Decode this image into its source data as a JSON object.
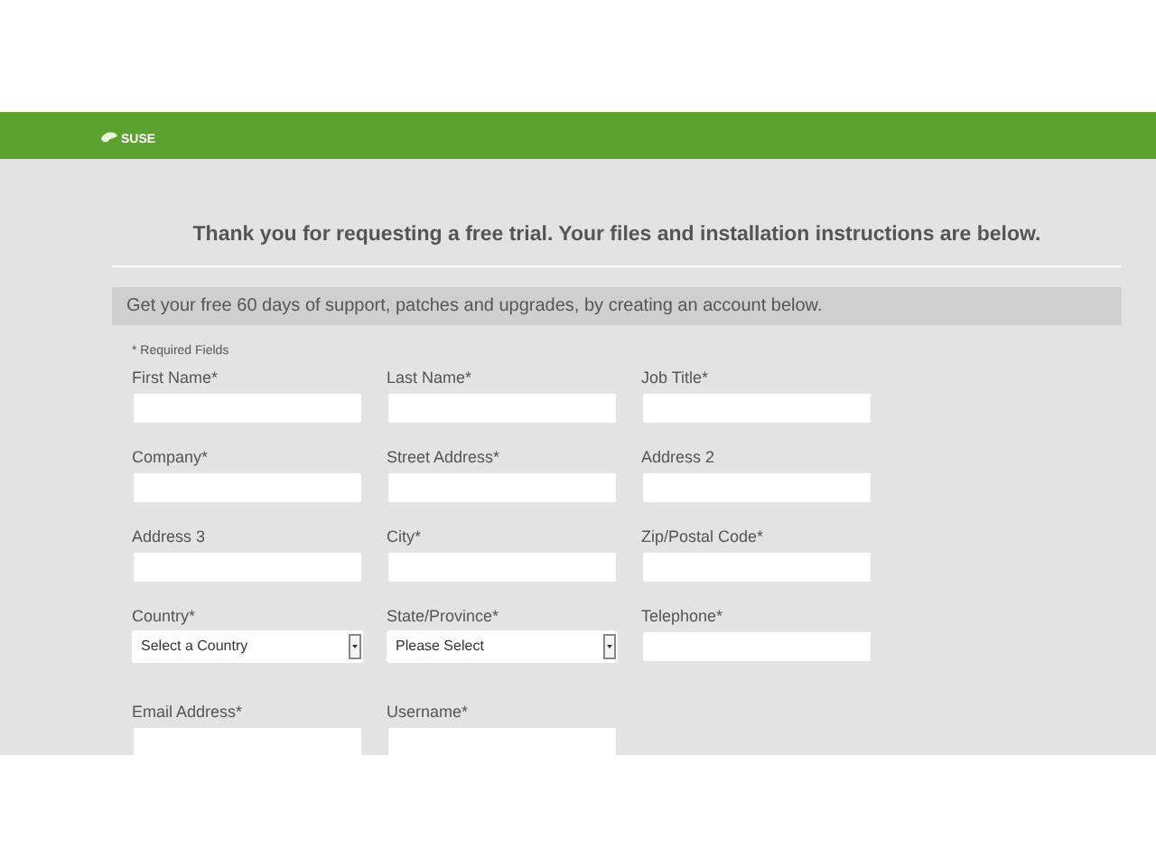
{
  "header": {
    "logo": "SUSE"
  },
  "heading": "Thank you for requesting a free trial. Your files and installation instructions are below.",
  "banner": "Get your free 60 days of support, patches and upgrades, by creating an account below.",
  "required_note": "* Required Fields",
  "form_rows": [
    [
      {
        "kind": "text",
        "label": "First Name*"
      },
      {
        "kind": "text",
        "label": "Last Name*"
      },
      {
        "kind": "text",
        "label": "Job Title*"
      }
    ],
    [
      {
        "kind": "text",
        "label": "Company*"
      },
      {
        "kind": "text",
        "label": "Street Address*"
      },
      {
        "kind": "text",
        "label": "Address 2"
      }
    ],
    [
      {
        "kind": "text",
        "label": "Address 3"
      },
      {
        "kind": "text",
        "label": "City*"
      },
      {
        "kind": "text",
        "label": "Zip/Postal Code*"
      }
    ],
    [
      {
        "kind": "select",
        "label": "Country*",
        "value": "Select a Country"
      },
      {
        "kind": "select",
        "label": "State/Province*",
        "value": "Please Select"
      },
      {
        "kind": "text",
        "label": "Telephone*"
      }
    ],
    [
      {
        "kind": "text",
        "label": "Email Address*"
      },
      {
        "kind": "text",
        "label": "Username*"
      }
    ]
  ]
}
